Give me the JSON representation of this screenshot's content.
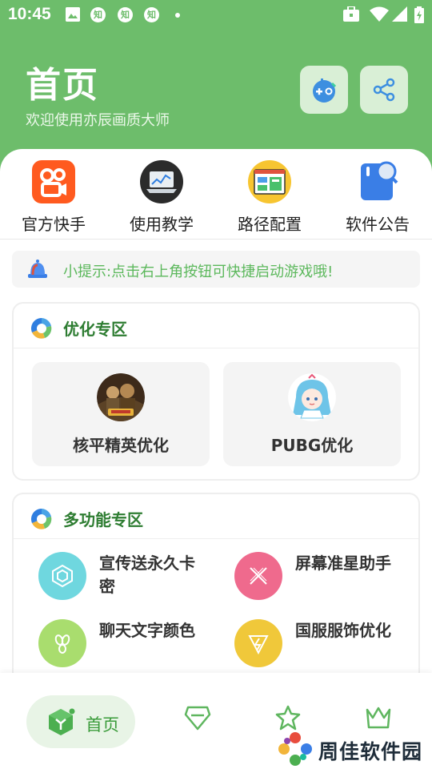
{
  "status_bar": {
    "time": "10:45",
    "zhi_badges": [
      "知",
      "知",
      "知"
    ]
  },
  "header": {
    "title": "首页",
    "subtitle": "欢迎使用亦辰画质大师",
    "buttons": [
      {
        "name": "game-controller-icon"
      },
      {
        "name": "share-icon"
      }
    ]
  },
  "quick_entries": [
    {
      "label": "官方快手",
      "icon": "kuaishou-icon"
    },
    {
      "label": "使用教学",
      "icon": "laptop-tutorial-icon"
    },
    {
      "label": "路径配置",
      "icon": "path-config-icon"
    },
    {
      "label": "软件公告",
      "icon": "announcement-icon"
    }
  ],
  "tip": {
    "text": "小提示:点击右上角按钮可快捷启动游戏哦!"
  },
  "optimize_section": {
    "title": "优化专区",
    "cards": [
      {
        "label": "核平精英优化",
        "icon": "pubg-mobile-avatar"
      },
      {
        "label": "PUBG优化",
        "icon": "anime-girl-avatar"
      }
    ]
  },
  "multi_section": {
    "title": "多功能专区",
    "items": [
      {
        "label": "宣传送永久卡密",
        "icon": "hexagon-icon",
        "color": "#6fd7df"
      },
      {
        "label": "屏幕准星助手",
        "icon": "crosshair-icon",
        "color": "#ef6a8d"
      },
      {
        "label": "聊天文字颜色",
        "icon": "petals-icon",
        "color": "#a9dd6e"
      },
      {
        "label": "国服服饰优化",
        "icon": "lightning-icon",
        "color": "#f0c83a"
      }
    ]
  },
  "bottom_nav": {
    "items": [
      {
        "label": "首页",
        "icon": "home-cube-icon",
        "active": true
      },
      {
        "icon": "diamond-icon",
        "active": false
      },
      {
        "icon": "star-person-icon",
        "active": false
      },
      {
        "icon": "crown-icon",
        "active": false
      }
    ]
  },
  "watermark": {
    "text": "周佳软件园"
  },
  "colors": {
    "primary_green": "#6dbd6b",
    "tip_text": "#5cb85c",
    "section_title": "#2e7d32"
  }
}
